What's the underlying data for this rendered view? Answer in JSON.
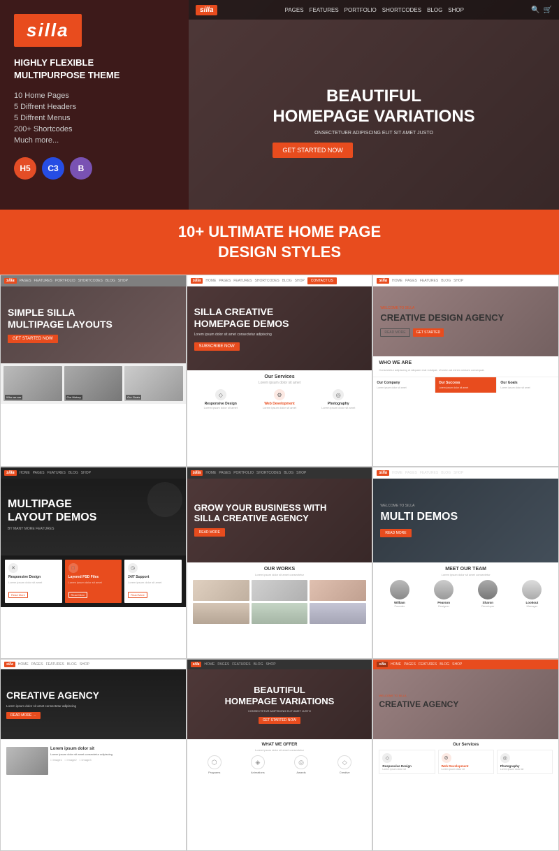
{
  "brand": {
    "name": "silla",
    "tagline1": "HIGHLY FLEXIBLE",
    "tagline2": "MULTIPURPOSE THEME"
  },
  "features": [
    "10 Home Pages",
    "5 Diffrent Headers",
    "5 Diffrent Menus",
    "200+ Shortcodes",
    "Much more..."
  ],
  "hero": {
    "title1": "BEAUTIFUL",
    "title2": "HOMEPAGE VARIATIONS",
    "subtitle": "ONSECTETUER ADIPISCING ELIT SIT AMET JUSTO",
    "cta": "GET STARTED NOW"
  },
  "nav": {
    "links": [
      "PAGES",
      "FEATURES",
      "PORTFOLIO",
      "SHORTCODES",
      "BLOG",
      "SHOP"
    ]
  },
  "banner": {
    "line1": "10+ ULTIMATE HOME PAGE",
    "line2": "DESIGN STYLES"
  },
  "demos": [
    {
      "id": 1,
      "label": "silla",
      "title1": "SIMPLE SILLA",
      "title2": "MULTIPAGE LAYOUTS",
      "cta": "GET STARTED NOW",
      "thumbs": [
        "Who we are",
        "Our History",
        "Our Goals"
      ]
    },
    {
      "id": 2,
      "label": "silla",
      "title1": "SILLA CREATIVE",
      "title2": "HOMEPAGE DEMOS",
      "subtitle": "Lorem ipsum dolor sit amet consectetur adipiscing",
      "cta": "SUBSCRIBE NOW",
      "services_title": "Our Services",
      "services": [
        {
          "name": "Responsive Design",
          "icon": "◇"
        },
        {
          "name": "Web Development",
          "icon": "⚙",
          "red": true
        },
        {
          "name": "Photography",
          "icon": "◎"
        }
      ]
    },
    {
      "id": 3,
      "label": "silla",
      "welcome": "WELCOME TO SILLA",
      "title1": "CREATIVE DESIGN AGENCY",
      "btns": [
        "READ MORE",
        "GET STARTED"
      ],
      "who_title": "WHO WE ARE",
      "who_desc": "Consectetur adipiscing ut aliquam erat volutpat. Ut enim ad minim veniam consequat.",
      "bottom": [
        {
          "title": "Our Company",
          "active": false
        },
        {
          "title": "Our Success",
          "active": true
        },
        {
          "title": "Our Goals",
          "active": false
        }
      ]
    },
    {
      "id": 4,
      "label": "silla",
      "title1": "MULTIPAGE",
      "title2": "LAYOUT DEMOS",
      "sub": "BY MANY MORE FEATURES",
      "cards": [
        {
          "title": "Responsive Design",
          "icon": "✕",
          "desc": "Lorem ipsum dolor sit amet"
        },
        {
          "title": "Layered PSD Files",
          "icon": "□",
          "desc": "Lorem ipsum dolor sit amet",
          "highlighted": true
        },
        {
          "title": "24/7 Support",
          "icon": "◷",
          "desc": "Lorem ipsum dolor sit amet"
        }
      ]
    },
    {
      "id": 5,
      "label": "silla",
      "title": "GROW YOUR BUSINESS WITH\nSILLA CREATIVE AGENCY",
      "cta": "READ MORE",
      "works_title": "OUR WORKS",
      "works_sub": "Lorem ipsum dolor sit amet consectetur"
    },
    {
      "id": 6,
      "label": "silla",
      "welcome": "WELCOME TO SILLA",
      "title": "MULTI DEMOS",
      "cta": "READ MORE",
      "team_title": "MEET OUR TEAM",
      "team_sub": "Lorem ipsum dolor sit amet consectetur",
      "team": [
        {
          "name": "William",
          "role": "Founder"
        },
        {
          "name": "Pearson",
          "role": "Designer"
        },
        {
          "name": "Sharon",
          "role": "Developer"
        },
        {
          "name": "Lookout",
          "role": "Manager"
        }
      ]
    },
    {
      "id": 7,
      "label": "silla",
      "title": "CREATIVE AGENCY",
      "sub": "Lorem ipsum dolor sit amet consectetur adipiscing",
      "cta": "READ MORE →"
    },
    {
      "id": 8,
      "label": "silla",
      "title1": "BEAUTIFUL",
      "title2": "HOMEPAGE VARIATIONS",
      "sub": "CONSECTETUR ADIPISCING ELIT AMET JUSTO",
      "cta": "GET STARTED NOW",
      "offer_title": "WHAT WE OFFER",
      "offer_sub": "Lorem ipsum dolor sit amet consectetur",
      "icons": [
        {
          "icon": "⬡",
          "label": "Programs"
        },
        {
          "icon": "◈",
          "label": "Animations"
        },
        {
          "icon": "◎",
          "label": "Awards"
        },
        {
          "icon": "◇",
          "label": "Creative"
        }
      ]
    },
    {
      "id": 9,
      "label": "silla",
      "welcome": "WELCOME TO SILLA",
      "title": "CREATIVE AGENCY",
      "services_title": "Our Services",
      "services": [
        {
          "name": "Responsive Design",
          "icon": "◇"
        },
        {
          "name": "Web Development",
          "icon": "⚙",
          "red": true
        },
        {
          "name": "Photography",
          "icon": "◎"
        }
      ]
    }
  ]
}
